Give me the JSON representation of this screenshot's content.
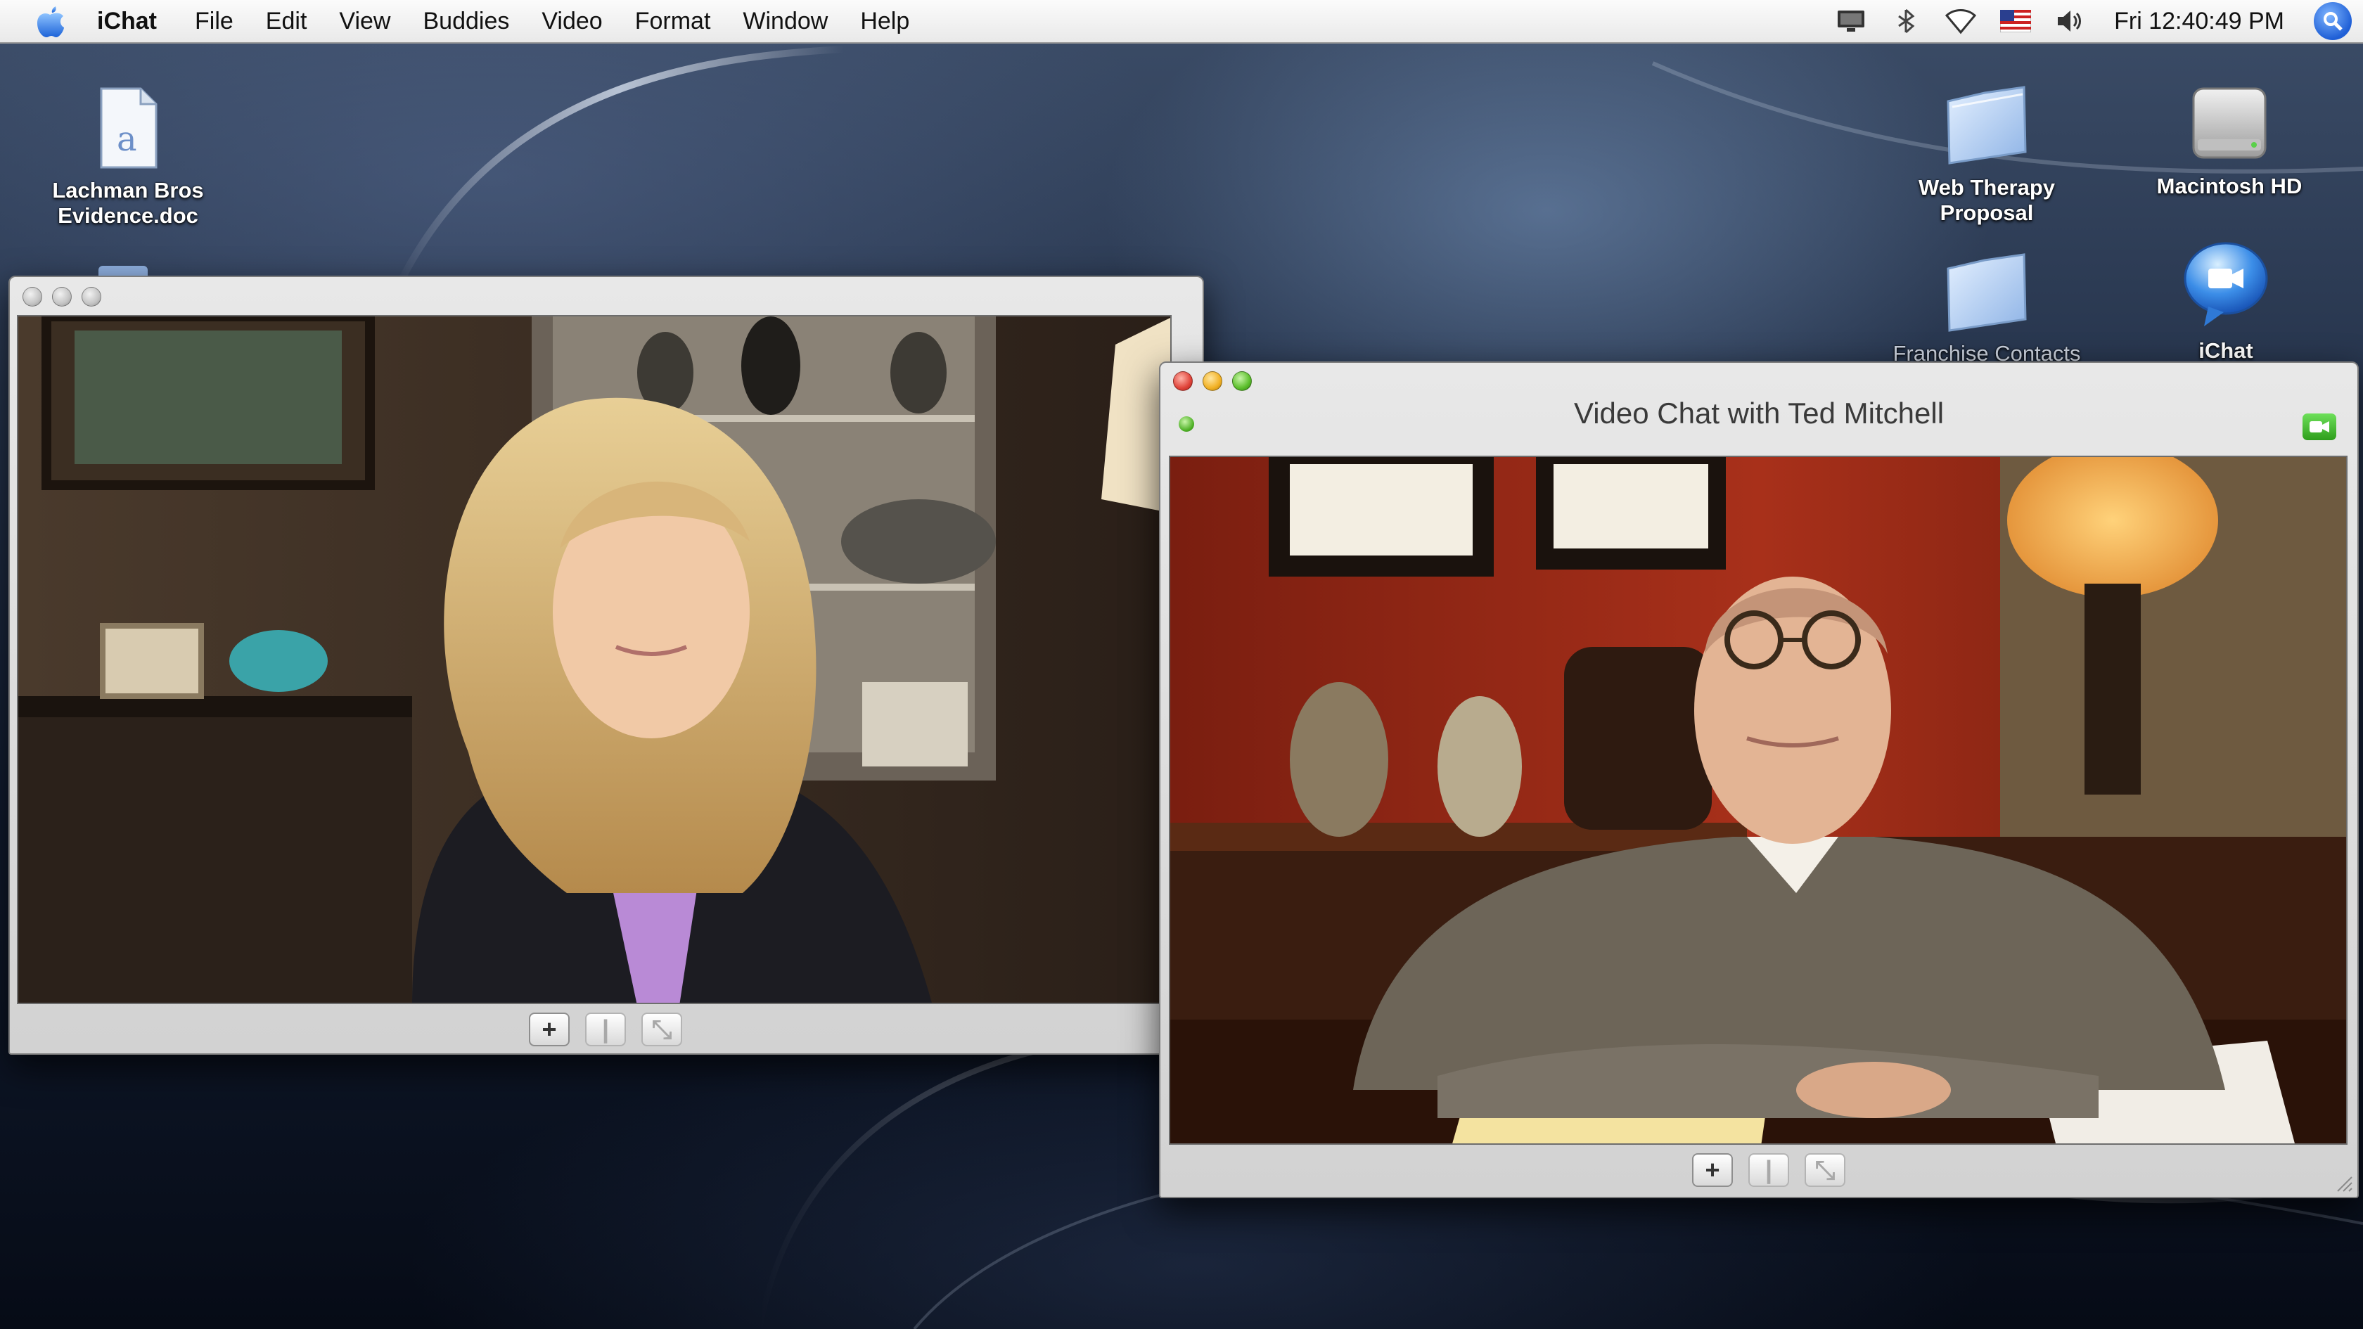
{
  "menubar": {
    "app_name": "iChat",
    "items": [
      "File",
      "Edit",
      "View",
      "Buddies",
      "Video",
      "Format",
      "Window",
      "Help"
    ],
    "clock": "Fri 12:40:49 PM",
    "status_icons": [
      "display-icon",
      "bluetooth-icon",
      "wifi-icon",
      "us-flag-icon",
      "volume-icon"
    ]
  },
  "desktop": {
    "icons": [
      {
        "label_line1": "Lachman Bros",
        "label_line2": "Evidence.doc",
        "icon": "document-icon"
      },
      {
        "label_line1": "Web Therapy",
        "label_line2": "Proposal",
        "icon": "folder-icon"
      },
      {
        "label_line1": "Macintosh HD",
        "label_line2": "",
        "icon": "hard-drive-icon"
      },
      {
        "label_line1": "Franchise Contacts",
        "label_line2": "",
        "icon": "folder-icon"
      },
      {
        "label_line1": "iChat",
        "label_line2": "",
        "icon": "ichat-icon"
      }
    ]
  },
  "local_video_window": {
    "title": "",
    "toolbar": [
      "+",
      "|",
      "⤡"
    ]
  },
  "chat_window": {
    "title": "Video Chat with Ted Mitchell",
    "toolbar": [
      "+",
      "|",
      "⤡"
    ]
  },
  "colors": {
    "menubar_bg": "#f2f2f2",
    "window_chrome": "#dcdcdc",
    "close_red": "#e0443a",
    "minimize_yellow": "#f2b124",
    "zoom_green": "#5cbf2c",
    "spotlight_blue": "#1f5fd6"
  }
}
